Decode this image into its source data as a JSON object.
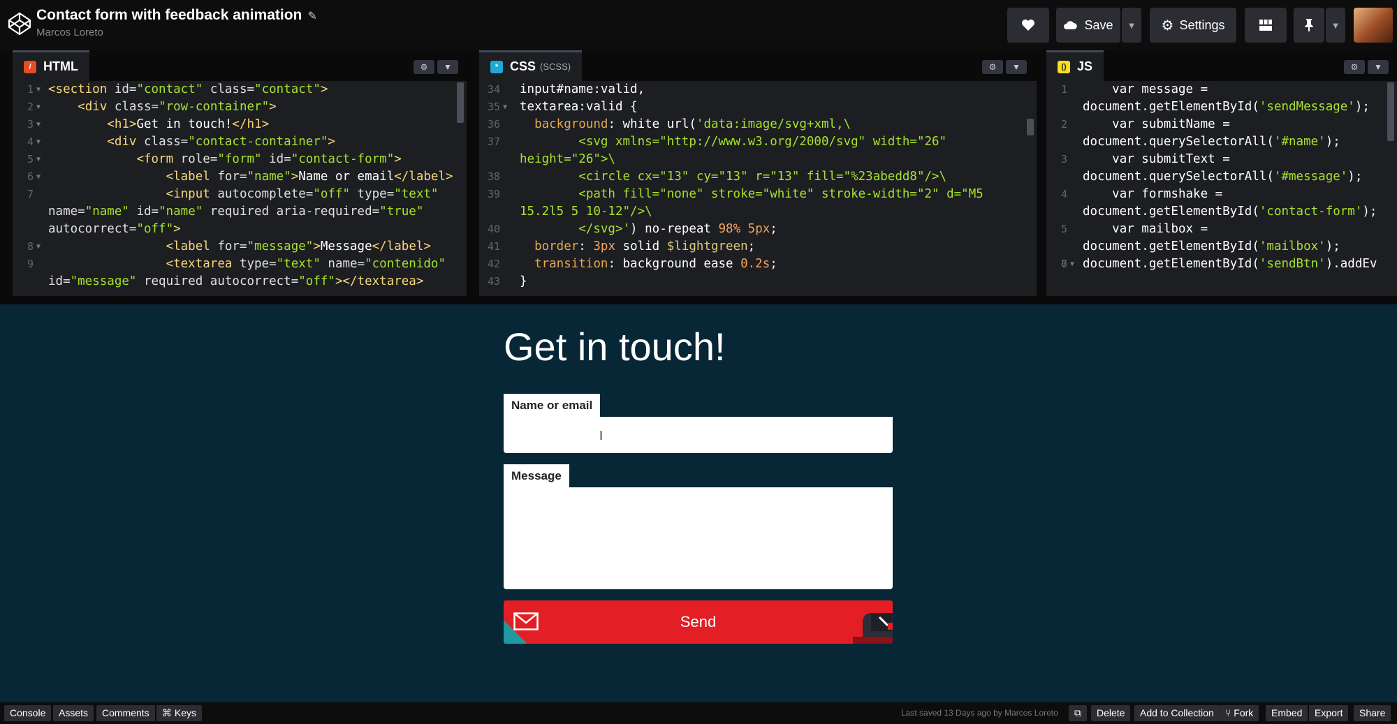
{
  "header": {
    "pen_title": "Contact form with feedback animation",
    "author": "Marcos Loreto",
    "save_label": "Save",
    "settings_label": "Settings"
  },
  "editors": {
    "html": {
      "label": "HTML",
      "lines": [
        {
          "n": "1",
          "fold": true,
          "html": "<span class='t-tag'>&lt;section</span> <span class='t-attr'>id=</span><span class='t-str'>\"contact\"</span> <span class='t-attr'>class=</span><span class='t-str'>\"contact\"</span><span class='t-tag'>&gt;</span>"
        },
        {
          "n": "2",
          "fold": true,
          "html": "    <span class='t-tag'>&lt;div</span> <span class='t-attr'>class=</span><span class='t-str'>\"row-container\"</span><span class='t-tag'>&gt;</span>"
        },
        {
          "n": "3",
          "fold": true,
          "html": "        <span class='t-tag'>&lt;h1&gt;</span>Get in touch!<span class='t-tag'>&lt;/h1&gt;</span>"
        },
        {
          "n": "4",
          "fold": true,
          "html": "        <span class='t-tag'>&lt;div</span> <span class='t-attr'>class=</span><span class='t-str'>\"contact-container\"</span><span class='t-tag'>&gt;</span>"
        },
        {
          "n": "5",
          "fold": true,
          "html": "            <span class='t-tag'>&lt;form</span> <span class='t-attr'>role=</span><span class='t-str'>\"form\"</span> <span class='t-attr'>id=</span><span class='t-str'>\"contact-form\"</span><span class='t-tag'>&gt;</span>"
        },
        {
          "n": "6",
          "fold": true,
          "html": "                <span class='t-tag'>&lt;label</span> <span class='t-attr'>for=</span><span class='t-str'>\"name\"</span><span class='t-tag'>&gt;</span>Name or email<span class='t-tag'>&lt;/label&gt;</span>"
        },
        {
          "n": "7",
          "fold": false,
          "html": "                <span class='t-tag'>&lt;input</span> <span class='t-attr'>autocomplete=</span><span class='t-str'>\"off\"</span> <span class='t-attr'>type=</span><span class='t-str'>\"text\"</span>"
        },
        {
          "n": "",
          "fold": false,
          "html": "<span class='t-attr'>name=</span><span class='t-str'>\"name\"</span> <span class='t-attr'>id=</span><span class='t-str'>\"name\"</span> <span class='t-attr'>required aria-required=</span><span class='t-str'>\"true\"</span>"
        },
        {
          "n": "",
          "fold": false,
          "html": "<span class='t-attr'>autocorrect=</span><span class='t-str'>\"off\"</span><span class='t-tag'>&gt;</span>"
        },
        {
          "n": "8",
          "fold": true,
          "html": "                <span class='t-tag'>&lt;label</span> <span class='t-attr'>for=</span><span class='t-str'>\"message\"</span><span class='t-tag'>&gt;</span>Message<span class='t-tag'>&lt;/label&gt;</span>"
        },
        {
          "n": "9",
          "fold": false,
          "html": "                <span class='t-tag'>&lt;textarea</span> <span class='t-attr'>type=</span><span class='t-str'>\"text\"</span> <span class='t-attr'>name=</span><span class='t-str'>\"contenido\"</span>"
        },
        {
          "n": "",
          "fold": false,
          "html": "<span class='t-attr'>id=</span><span class='t-str'>\"message\"</span> <span class='t-attr'>required autocorrect=</span><span class='t-str'>\"off\"</span><span class='t-tag'>&gt;&lt;/textarea&gt;</span>"
        }
      ]
    },
    "css": {
      "label": "CSS",
      "sublabel": "(SCSS)",
      "lines": [
        {
          "n": "34",
          "fold": false,
          "html": "<span class='t-sel'>input#name:valid,</span>"
        },
        {
          "n": "35",
          "fold": true,
          "html": "<span class='t-sel'>textarea:valid {</span>"
        },
        {
          "n": "36",
          "fold": false,
          "html": "  <span class='t-prop'>background</span>: <span class='t-kw'>white</span> <span class='t-kw'>url(</span><span class='t-str'>'data:image/svg+xml,\\</span>"
        },
        {
          "n": "37",
          "fold": false,
          "html": "<span class='t-str'>        &lt;svg xmlns=\"http://www.w3.org/2000/svg\" width=\"26\"</span>"
        },
        {
          "n": "",
          "fold": false,
          "html": "<span class='t-str'>height=\"26\"&gt;\\</span>"
        },
        {
          "n": "38",
          "fold": false,
          "html": "<span class='t-str'>        &lt;circle cx=\"13\" cy=\"13\" r=\"13\" fill=\"%23abedd8\"/&gt;\\</span>"
        },
        {
          "n": "39",
          "fold": false,
          "html": "<span class='t-str'>        &lt;path fill=\"none\" stroke=\"white\" stroke-width=\"2\" d=\"M5</span>"
        },
        {
          "n": "",
          "fold": false,
          "html": "<span class='t-str'>15.2l5 5 10-12\"/&gt;\\</span>"
        },
        {
          "n": "40",
          "fold": false,
          "html": "<span class='t-str'>        &lt;/svg&gt;'</span><span class='t-kw'>)</span> <span class='t-kw'>no-repeat</span> <span class='t-num'>98%</span> <span class='t-num'>5px</span>;"
        },
        {
          "n": "41",
          "fold": false,
          "html": "  <span class='t-prop'>border</span>: <span class='t-num'>3px</span> <span class='t-kw'>solid</span> <span class='t-var'>$lightgreen</span>;"
        },
        {
          "n": "42",
          "fold": false,
          "html": "  <span class='t-prop'>transition</span>: <span class='t-kw'>background ease</span> <span class='t-num'>0.2s</span>;"
        },
        {
          "n": "43",
          "fold": false,
          "html": "<span class='t-sel'>}</span>"
        }
      ]
    },
    "js": {
      "label": "JS",
      "lines": [
        {
          "n": "1",
          "fold": false,
          "html": "    <span class='t-kw'>var</span> message ="
        },
        {
          "n": "",
          "fold": false,
          "html": "document.getElementById(<span class='t-str'>'sendMessage'</span>);"
        },
        {
          "n": "2",
          "fold": false,
          "html": "    <span class='t-kw'>var</span> submitName ="
        },
        {
          "n": "",
          "fold": false,
          "html": "document.querySelectorAll(<span class='t-str'>'#name'</span>);"
        },
        {
          "n": "3",
          "fold": false,
          "html": "    <span class='t-kw'>var</span> submitText ="
        },
        {
          "n": "",
          "fold": false,
          "html": "document.querySelectorAll(<span class='t-str'>'#message'</span>);"
        },
        {
          "n": "4",
          "fold": false,
          "html": "    <span class='t-kw'>var</span> formshake ="
        },
        {
          "n": "",
          "fold": false,
          "html": "document.getElementById(<span class='t-str'>'contact-form'</span>);"
        },
        {
          "n": "5",
          "fold": false,
          "html": "    <span class='t-kw'>var</span> mailbox ="
        },
        {
          "n": "",
          "fold": false,
          "html": "document.getElementById(<span class='t-str'>'mailbox'</span>);"
        },
        {
          "n": "6",
          "fold": false,
          "html": ""
        },
        {
          "n": "7",
          "fold": true,
          "html": "document.getElementById(<span class='t-str'>'sendBtn'</span>).addEv"
        }
      ]
    }
  },
  "preview": {
    "title": "Get in touch!",
    "name_label": "Name or email",
    "message_label": "Message",
    "send_label": "Send"
  },
  "footer": {
    "left": [
      "Console",
      "Assets",
      "Comments",
      "⌘ Keys"
    ],
    "note": "Last saved 13 Days ago by Marcos Loreto",
    "delete": "Delete",
    "add_to_collection": "Add to Collection",
    "fork": "Fork",
    "embed": "Embed",
    "export": "Export",
    "share": "Share"
  },
  "colors": {
    "preview_bg": "#072636",
    "send_red": "#e31e24",
    "editor_bg": "#1d1e22"
  }
}
